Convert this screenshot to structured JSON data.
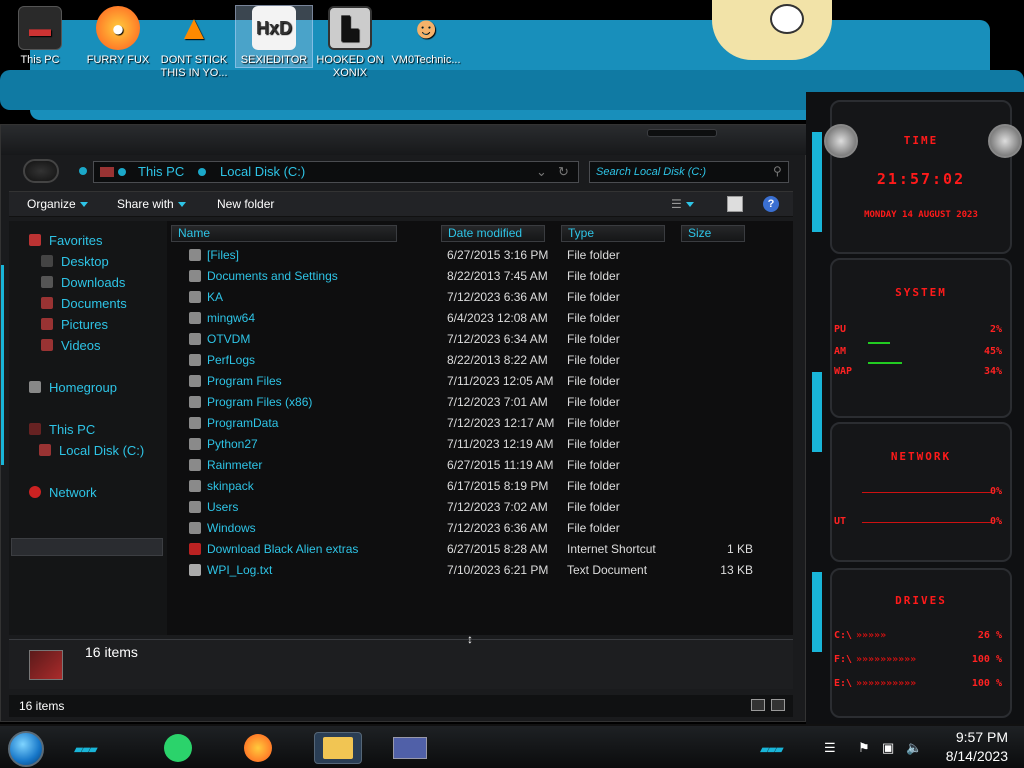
{
  "desktop_icons": [
    {
      "label": "This PC",
      "icon": "this-pc-icon"
    },
    {
      "label": "FURRY FUX",
      "icon": "firefox-icon"
    },
    {
      "label": "DONT STICK THIS IN YO...",
      "icon": "vlc-icon"
    },
    {
      "label": "SEXIEDITOR",
      "icon": "hex-editor-icon"
    },
    {
      "label": "HOOKED ON XONIX",
      "icon": "xonix-icon"
    },
    {
      "label": "VM0Technic...",
      "icon": "doctor-icon"
    }
  ],
  "explorer": {
    "address": {
      "this_pc": "This PC",
      "drive": "Local Disk (C:)"
    },
    "search_placeholder": "Search Local Disk (C:)",
    "toolbar": {
      "organize": "Organize",
      "share_with": "Share with",
      "new_folder": "New folder"
    },
    "nav": {
      "favorites": "Favorites",
      "desktop": "Desktop",
      "downloads": "Downloads",
      "documents": "Documents",
      "pictures": "Pictures",
      "videos": "Videos",
      "homegroup": "Homegroup",
      "this_pc": "This PC",
      "local_disk": "Local Disk (C:)",
      "network": "Network"
    },
    "columns": {
      "name": "Name",
      "date": "Date modified",
      "type": "Type",
      "size": "Size"
    },
    "files": [
      {
        "name": "[Files]",
        "date": "6/27/2015 3:16 PM",
        "type": "File folder",
        "size": ""
      },
      {
        "name": "Documents and Settings",
        "date": "8/22/2013 7:45 AM",
        "type": "File folder",
        "size": ""
      },
      {
        "name": "KA",
        "date": "7/12/2023 6:36 AM",
        "type": "File folder",
        "size": ""
      },
      {
        "name": "mingw64",
        "date": "6/4/2023 12:08 AM",
        "type": "File folder",
        "size": ""
      },
      {
        "name": "OTVDM",
        "date": "7/12/2023 6:34 AM",
        "type": "File folder",
        "size": ""
      },
      {
        "name": "PerfLogs",
        "date": "8/22/2013 8:22 AM",
        "type": "File folder",
        "size": ""
      },
      {
        "name": "Program Files",
        "date": "7/11/2023 12:05 AM",
        "type": "File folder",
        "size": ""
      },
      {
        "name": "Program Files (x86)",
        "date": "7/12/2023 7:01 AM",
        "type": "File folder",
        "size": ""
      },
      {
        "name": "ProgramData",
        "date": "7/12/2023 12:17 AM",
        "type": "File folder",
        "size": ""
      },
      {
        "name": "Python27",
        "date": "7/11/2023 12:19 AM",
        "type": "File folder",
        "size": ""
      },
      {
        "name": "Rainmeter",
        "date": "6/27/2015 11:19 AM",
        "type": "File folder",
        "size": ""
      },
      {
        "name": "skinpack",
        "date": "6/17/2015 8:19 PM",
        "type": "File folder",
        "size": ""
      },
      {
        "name": "Users",
        "date": "7/12/2023 7:02 AM",
        "type": "File folder",
        "size": ""
      },
      {
        "name": "Windows",
        "date": "7/12/2023 6:36 AM",
        "type": "File folder",
        "size": ""
      },
      {
        "name": "Download Black Alien extras",
        "date": "6/27/2015 8:28 AM",
        "type": "Internet Shortcut",
        "size": "1 KB"
      },
      {
        "name": "WPI_Log.txt",
        "date": "7/10/2023 6:21 PM",
        "type": "Text Document",
        "size": "13 KB"
      }
    ],
    "details_count": "16 items",
    "status_count": "16 items"
  },
  "gadget": {
    "time_title": "TIME",
    "time": "21:57:02",
    "date": "MONDAY 14 AUGUST 2023",
    "system_title": "SYSTEM",
    "cpu_label": "PU",
    "cpu_val": "2%",
    "ram_label": "AM",
    "ram_val": "45%",
    "swap_label": "WAP",
    "swap_val": "34%",
    "network_title": "NETWORK",
    "net_in": "0%",
    "net_out_label": "UT",
    "net_out": "0%",
    "drives_title": "DRIVES",
    "drives": [
      {
        "label": "C:\\",
        "val": "26 %"
      },
      {
        "label": "F:\\",
        "val": "100 %"
      },
      {
        "label": "E:\\",
        "val": "100 %"
      }
    ]
  },
  "taskbar": {
    "time": "9:57 PM",
    "date": "8/14/2023"
  },
  "colors": {
    "accent": "#2ec4e6",
    "gadget_red": "#ff1a1a"
  }
}
